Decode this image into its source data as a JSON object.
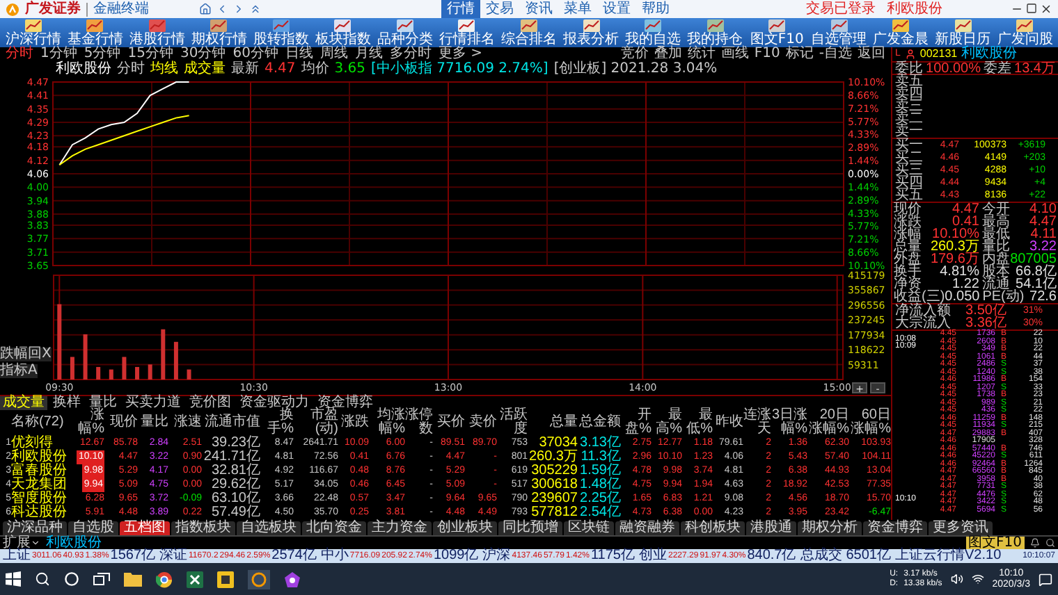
{
  "header": {
    "brand": "广发证券",
    "product": "金融终端",
    "menus": [
      {
        "label": "行情",
        "selected": true
      },
      {
        "label": "交易",
        "selected": false
      },
      {
        "label": "资讯",
        "selected": false
      },
      {
        "label": "菜单",
        "selected": false
      },
      {
        "label": "设置",
        "selected": false
      },
      {
        "label": "帮助",
        "selected": false
      }
    ],
    "notice": "交易已登录",
    "notice_stock": "利欧股份"
  },
  "toolbar": [
    "沪深行情",
    "基金行情",
    "港股行情",
    "期权行情",
    "股转指数",
    "板块指数",
    "品种分类",
    "行情排名",
    "综合排名",
    "报表分析",
    "我的自选",
    "我的持仓",
    "图文F10",
    "自选管理",
    "广发金晨",
    "新股日历",
    "广发问股"
  ],
  "periods": [
    {
      "label": "分时",
      "selected": true
    },
    {
      "label": "1分钟",
      "selected": false
    },
    {
      "label": "5分钟",
      "selected": false
    },
    {
      "label": "15分钟",
      "selected": false
    },
    {
      "label": "30分钟",
      "selected": false
    },
    {
      "label": "60分钟",
      "selected": false
    },
    {
      "label": "日线",
      "selected": false
    },
    {
      "label": "周线",
      "selected": false
    },
    {
      "label": "月线",
      "selected": false
    },
    {
      "label": "多分时",
      "selected": false
    },
    {
      "label": "更多 >",
      "selected": false
    }
  ],
  "tools": [
    "竞价",
    "叠加",
    "统计",
    "画线",
    "F10",
    "标记",
    "-自选",
    "返回"
  ],
  "chart": {
    "info_head": [
      {
        "text": "利欧股份",
        "kind": "name"
      },
      {
        "text": "分时",
        "kind": "label"
      }
    ],
    "info_tail": [
      {
        "text": "4.47",
        "kind": "up"
      },
      {
        "text": "均价",
        "kind": "label"
      },
      {
        "text": "3.65",
        "kind": "down"
      },
      {
        "text": "[中小板指 7716.09 2.74%]",
        "kind": "index"
      },
      {
        "text": "[创业板] 2021.28 3.04%",
        "kind": "label"
      }
    ],
    "price": {
      "chart_data": {
        "type": "line",
        "grid": true,
        "categories": [
          null,
          null,
          null,
          null,
          null,
          null,
          null,
          null,
          null,
          null,
          null,
          null,
          null,
          null,
          null,
          null,
          null,
          null,
          null,
          null,
          null,
          null,
          null,
          null,
          null,
          null,
          null,
          null,
          null,
          null,
          null,
          null,
          null,
          null,
          null,
          null,
          null,
          null,
          null,
          null,
          null,
          null,
          null,
          null,
          null,
          null,
          null,
          null,
          null,
          null,
          null,
          null,
          null,
          null,
          null,
          null,
          null,
          null,
          null,
          null,
          null
        ],
        "ylim": [
          3.65,
          4.47
        ],
        "yticks": [
          {
            "value": 4.47,
            "label": "4.47"
          },
          {
            "value": 4.41,
            "label": "4.41"
          },
          {
            "value": 4.35,
            "label": "4.35"
          },
          {
            "value": 4.29,
            "label": "4.29"
          },
          {
            "value": 4.23,
            "label": "4.23"
          },
          {
            "value": 4.18,
            "label": "4.18"
          },
          {
            "value": 4.12,
            "label": "4.12"
          },
          {
            "value": 4.06,
            "label": "4.06"
          },
          {
            "value": 4.0,
            "label": "4.00"
          },
          {
            "value": 3.94,
            "label": "3.94"
          },
          {
            "value": 3.88,
            "label": "3.88"
          },
          {
            "value": 3.83,
            "label": "3.83"
          },
          {
            "value": 3.77,
            "label": "3.77"
          },
          {
            "value": 3.71,
            "label": "3.71"
          },
          {
            "value": 3.65,
            "label": "3.65"
          }
        ],
        "series": [
          {
            "name": "最新",
            "color": "#ffffff",
            "values": [
              4.1,
              4.19,
              4.22,
              4.26,
              4.28,
              4.29,
              4.33,
              4.41,
              4.44,
              4.47,
              4.47,
              null,
              null,
              null,
              null,
              null,
              null,
              null,
              null,
              null,
              null,
              null,
              null,
              null,
              null,
              null,
              null,
              null,
              null,
              null,
              null,
              null,
              null,
              null,
              null,
              null,
              null,
              null,
              null,
              null,
              null,
              null,
              null,
              null,
              null,
              null,
              null,
              null,
              null,
              null,
              null,
              null,
              null,
              null,
              null,
              null,
              null,
              null,
              null,
              null,
              null
            ]
          },
          {
            "name": "均线",
            "color": "#ffff00",
            "values": [
              4.1,
              4.14,
              4.17,
              4.19,
              4.21,
              4.23,
              4.25,
              4.27,
              4.29,
              4.31,
              4.32,
              null,
              null,
              null,
              null,
              null,
              null,
              null,
              null,
              null,
              null,
              null,
              null,
              null,
              null,
              null,
              null,
              null,
              null,
              null,
              null,
              null,
              null,
              null,
              null,
              null,
              null,
              null,
              null,
              null,
              null,
              null,
              null,
              null,
              null,
              null,
              null,
              null,
              null,
              null,
              null,
              null,
              null,
              null,
              null,
              null,
              null,
              null,
              null,
              null,
              null
            ]
          }
        ]
      }
    },
    "pct_ticks": [
      "10.10%",
      "8.66%",
      "7.21%",
      "5.77%",
      "4.33%",
      "2.89%",
      "1.44%",
      "0.00%",
      "1.44%",
      "2.89%",
      "4.33%",
      "5.77%",
      "7.21%",
      "8.66%",
      "10.10%"
    ],
    "volume": {
      "chart_data": {
        "type": "bar",
        "grid": true,
        "categories": [
          "09:30",
          null,
          null,
          null,
          null,
          null,
          null,
          null,
          null,
          null,
          null,
          null,
          null,
          null,
          null,
          "10:30",
          null,
          null,
          null,
          null,
          null,
          null,
          null,
          null,
          null,
          null,
          null,
          null,
          null,
          null,
          "13:00",
          null,
          null,
          null,
          null,
          null,
          null,
          null,
          null,
          null,
          null,
          null,
          null,
          null,
          null,
          "14:00",
          null,
          null,
          null,
          null,
          null,
          null,
          null,
          null,
          null,
          null,
          null,
          null,
          null,
          null,
          "15:00"
        ],
        "ylim": [
          0,
          415179
        ],
        "yticks": [
          59311,
          118622,
          177934,
          237245,
          296556,
          355867,
          415179
        ],
        "series": [
          {
            "name": "成交量",
            "color": "#d03030",
            "values": [
              300000,
              90000,
              180000,
              50000,
              40000,
              90000,
              50000,
              60000,
              200000,
              150000,
              40000,
              null,
              null,
              null,
              null,
              null,
              null,
              null,
              null,
              null,
              null,
              null,
              null,
              null,
              null,
              null,
              null,
              null,
              null,
              null,
              null,
              null,
              null,
              null,
              null,
              null,
              null,
              null,
              null,
              null,
              null,
              null,
              null,
              null,
              null,
              null,
              null,
              null,
              null,
              null,
              null,
              null,
              null,
              null,
              null,
              null,
              null,
              null,
              null,
              null,
              null
            ]
          }
        ]
      }
    },
    "side_buttons": [
      "跌幅回X",
      "指标A"
    ],
    "zoom_buttons": [
      "+",
      "-"
    ]
  },
  "table": {
    "tabs": [
      {
        "label": "成交量",
        "selected": true
      },
      {
        "label": "换样",
        "selected": false
      },
      {
        "label": "量比",
        "selected": false
      },
      {
        "label": "买卖力道",
        "selected": false
      },
      {
        "label": "竞价图",
        "selected": false
      },
      {
        "label": "资金驱动力",
        "selected": false
      },
      {
        "label": "资金博弈",
        "selected": false
      }
    ],
    "columns": [
      "",
      "名称(72)",
      "涨幅%",
      "现价",
      "量比",
      "涨速",
      "流通市值",
      "换手%",
      "市盈(动)",
      "涨跌",
      "均涨幅%",
      "涨停数",
      "买价",
      "卖价",
      "活跃度",
      "总量",
      "总金额",
      "开盘%",
      "最高%",
      "最低%",
      "昨收",
      "连涨天",
      "3日涨幅%",
      "20日涨幅%",
      "60日涨幅%"
    ],
    "rows": [
      {
        "limit_up": false,
        "cells": [
          "1",
          "优刻得",
          "12.67",
          "85.78",
          "2.84",
          "2.51",
          "39.23亿",
          "8.47",
          "2641.71",
          "10.09",
          "6.00",
          "-",
          "89.51",
          "89.70",
          "753",
          "37034",
          "3.13亿",
          "2.75",
          "12.77",
          "1.18",
          "79.61",
          "2",
          "1.36",
          "62.30",
          "103.93"
        ]
      },
      {
        "limit_up": true,
        "cells": [
          "2",
          "利欧股份",
          "10.10",
          "4.47",
          "3.22",
          "0.90",
          "241.71亿",
          "4.81",
          "72.56",
          "0.41",
          "6.76",
          "-",
          "4.47",
          "-",
          "801",
          "260.3万",
          "11.3亿",
          "2.96",
          "10.10",
          "1.23",
          "4.06",
          "2",
          "5.43",
          "57.40",
          "104.11"
        ]
      },
      {
        "limit_up": true,
        "cells": [
          "3",
          "富春股份",
          "9.98",
          "5.29",
          "4.17",
          "0.00",
          "32.81亿",
          "4.92",
          "116.67",
          "0.48",
          "8.76",
          "-",
          "5.29",
          "-",
          "619",
          "305229",
          "1.59亿",
          "4.78",
          "9.98",
          "3.74",
          "4.81",
          "2",
          "6.38",
          "44.93",
          "13.04"
        ]
      },
      {
        "limit_up": true,
        "cells": [
          "4",
          "天龙集团",
          "9.94",
          "5.09",
          "4.75",
          "0.00",
          "29.62亿",
          "5.17",
          "34.05",
          "0.46",
          "6.45",
          "-",
          "5.09",
          "-",
          "517",
          "300618",
          "1.48亿",
          "4.75",
          "9.94",
          "1.94",
          "4.63",
          "2",
          "18.92",
          "42.53",
          "77.35"
        ]
      },
      {
        "limit_up": false,
        "cells": [
          "5",
          "智度股份",
          "6.28",
          "9.65",
          "3.72",
          {
            "v": "-0.09",
            "down": true
          },
          "63.10亿",
          "3.66",
          "22.48",
          "0.57",
          "3.47",
          "-",
          "9.64",
          "9.65",
          "790",
          "239607",
          "2.25亿",
          "1.65",
          "6.83",
          "1.21",
          "9.08",
          "2",
          "4.56",
          "18.70",
          "15.70"
        ]
      },
      {
        "limit_up": false,
        "cells": [
          "6",
          "科达股份",
          "5.91",
          "4.48",
          "3.89",
          "0.22",
          "57.49亿",
          "4.50",
          "35.70",
          "0.25",
          "3.81",
          "-",
          "4.48",
          "4.49",
          "793",
          "577812",
          "2.54亿",
          "4.73",
          "6.38",
          "0.00",
          "4.23",
          "2",
          "3.95",
          "23.42",
          {
            "v": "-6.47",
            "down": true
          }
        ]
      }
    ]
  },
  "bottom_tabs": [
    {
      "label": "沪深品种",
      "selected": false
    },
    {
      "label": "自选股",
      "selected": false
    },
    {
      "label": "五档图",
      "selected": true
    },
    {
      "label": "指数板块",
      "selected": false
    },
    {
      "label": "自选板块",
      "selected": false
    },
    {
      "label": "北向资金",
      "selected": false
    },
    {
      "label": "主力资金",
      "selected": false
    },
    {
      "label": "创业板块",
      "selected": false
    },
    {
      "label": "同比预增",
      "selected": false
    },
    {
      "label": "区块链",
      "selected": false
    },
    {
      "label": "融资融券",
      "selected": false
    },
    {
      "label": "科创板块",
      "selected": false
    },
    {
      "label": "港股通",
      "selected": false
    },
    {
      "label": "期权分析",
      "selected": false
    },
    {
      "label": "资金博弈",
      "selected": false
    },
    {
      "label": "更多资讯",
      "selected": false
    }
  ],
  "quote": {
    "flag": "L",
    "code": "002131",
    "name": "利欧股份",
    "ratio": [
      {
        "label": "委比",
        "value": "100.00%"
      },
      {
        "label": "委差",
        "value": "13.4万"
      }
    ],
    "sells": [
      "卖五",
      "卖四",
      "卖三",
      "卖二",
      "卖一"
    ],
    "buys": [
      {
        "label": "买一",
        "price": "4.47",
        "volume": "100373",
        "change": "+3619"
      },
      {
        "label": "买二",
        "price": "4.46",
        "volume": "4149",
        "change": "+203"
      },
      {
        "label": "买三",
        "price": "4.45",
        "volume": "4288",
        "change": "+10"
      },
      {
        "label": "买四",
        "price": "4.44",
        "volume": "9434",
        "change": "+4"
      },
      {
        "label": "买五",
        "price": "4.43",
        "volume": "8136",
        "change": "+22"
      }
    ],
    "stats": [
      [
        {
          "label": "现价",
          "value": "4.47",
          "kind": "up"
        },
        {
          "label": "今开",
          "value": "4.10",
          "kind": "up"
        }
      ],
      [
        {
          "label": "涨跌",
          "value": "0.41",
          "kind": "up"
        },
        {
          "label": "最高",
          "value": "4.47",
          "kind": "up"
        }
      ],
      [
        {
          "label": "涨幅",
          "value": "10.10%",
          "kind": "up"
        },
        {
          "label": "最低",
          "value": "4.11",
          "kind": "up"
        }
      ],
      [
        {
          "label": "总量",
          "value": "260.3万",
          "kind": "volume"
        },
        {
          "label": "量比",
          "value": "3.22",
          "kind": "ratio"
        }
      ],
      [
        {
          "label": "外盘",
          "value": "179.6万",
          "kind": "up"
        },
        {
          "label": "内盘",
          "value": "807005",
          "kind": "down"
        }
      ],
      [
        {
          "label": "换手",
          "value": "4.81%",
          "kind": "plain"
        },
        {
          "label": "股本",
          "value": "66.8亿",
          "kind": "plain"
        }
      ],
      [
        {
          "label": "净资",
          "value": "1.22",
          "kind": "plain"
        },
        {
          "label": "流通",
          "value": "54.1亿",
          "kind": "plain"
        }
      ],
      [
        {
          "label": "收益(三)",
          "value": "0.050",
          "kind": "plain"
        },
        {
          "label": "PE(动)",
          "value": "72.6",
          "kind": "plain"
        }
      ]
    ],
    "funds": [
      {
        "label": "净流入额",
        "value": "3.50亿",
        "share": "31%"
      },
      {
        "label": "大宗流入",
        "value": "3.36亿",
        "share": "30%"
      }
    ],
    "ticks": [
      {
        "time": "10:08",
        "price": "4.45",
        "volume": "1736",
        "side": "B",
        "kind": "buy",
        "count": "22"
      },
      {
        "time": "10:09",
        "price": "4.45",
        "volume": "2608",
        "side": "B",
        "kind": "buy",
        "count": "10"
      },
      {
        "price": "4.45",
        "volume": "349",
        "side": "B",
        "kind": "buy",
        "count": "22"
      },
      {
        "price": "4.45",
        "volume": "1061",
        "side": "B",
        "kind": "buy",
        "count": "44"
      },
      {
        "price": "4.45",
        "volume": "2486",
        "side": "S",
        "kind": "sell",
        "count": "37"
      },
      {
        "price": "4.45",
        "volume": "1240",
        "side": "S",
        "kind": "sell",
        "count": "38"
      },
      {
        "price": "4.46",
        "volume": "11986",
        "side": "B",
        "kind": "buy",
        "count": "154"
      },
      {
        "price": "4.45",
        "volume": "1207",
        "side": "S",
        "kind": "sell",
        "count": "33"
      },
      {
        "price": "4.45",
        "volume": "1738",
        "side": "B",
        "kind": "buy",
        "count": "23"
      },
      {
        "price": "4.45",
        "volume": "989",
        "side": "S",
        "kind": "sell",
        "count": "21"
      },
      {
        "price": "4.45",
        "volume": "436",
        "side": "S",
        "kind": "sell",
        "count": "22"
      },
      {
        "price": "4.46",
        "volume": "11259",
        "side": "B",
        "kind": "buy",
        "count": "148"
      },
      {
        "price": "4.45",
        "volume": "11934",
        "side": "S",
        "kind": "sell",
        "count": "215"
      },
      {
        "price": "4.47",
        "volume": "29883",
        "side": "B",
        "kind": "buy",
        "count": "407"
      },
      {
        "price": "4.46",
        "volume": "17905",
        "kind": "neutral",
        "count": "328"
      },
      {
        "price": "4.46",
        "volume": "57440",
        "side": "B",
        "kind": "buy",
        "count": "746"
      },
      {
        "price": "4.46",
        "volume": "45220",
        "side": "S",
        "kind": "sell",
        "count": "611"
      },
      {
        "price": "4.46",
        "volume": "92464",
        "side": "B",
        "kind": "buy",
        "count": "1264"
      },
      {
        "price": "4.47",
        "volume": "66560",
        "side": "B",
        "kind": "buy",
        "count": "845"
      },
      {
        "price": "4.47",
        "volume": "3958",
        "side": "B",
        "kind": "buy",
        "count": "40"
      },
      {
        "price": "4.47",
        "volume": "7731",
        "side": "S",
        "kind": "sell",
        "count": "38"
      },
      {
        "time": "10:10",
        "price": "4.47",
        "volume": "4476",
        "side": "S",
        "kind": "sell",
        "count": "62"
      },
      {
        "price": "4.47",
        "volume": "3422",
        "side": "S",
        "kind": "sell",
        "count": "48"
      },
      {
        "price": "4.47",
        "volume": "5694",
        "side": "S",
        "kind": "sell",
        "count": "56"
      }
    ]
  },
  "status_bar": {
    "menu": "扩展",
    "stock": "利欧股份",
    "f10": "图文F10"
  },
  "index_bar": {
    "items": [
      {
        "name": "上证",
        "value": "3011.06",
        "change": "40.93",
        "pct": "1.38%",
        "amount": "1567亿"
      },
      {
        "name": "深证",
        "value": "11670.2",
        "change": "294.46",
        "pct": "2.59%",
        "amount": "2574亿"
      },
      {
        "name": "中小",
        "value": "7716.09",
        "change": "205.92",
        "pct": "2.74%",
        "amount": "1099亿"
      },
      {
        "name": "沪深",
        "value": "4137.46",
        "change": "57.79",
        "pct": "1.42%",
        "amount": "1175亿"
      },
      {
        "name": "创业",
        "value": "2227.29",
        "change": "91.97",
        "pct": "4.30%",
        "amount": "840.7亿"
      }
    ],
    "total_label": "总成交",
    "total": "6501亿",
    "notice": "上证云行情V2.10",
    "time": "10:10:07"
  },
  "taskbar": {
    "up_label": "U:",
    "up": "3.17 kb/s",
    "down_label": "D:",
    "down": "13.38 kb/s",
    "time": "10:10",
    "date": "2020/3/3"
  }
}
